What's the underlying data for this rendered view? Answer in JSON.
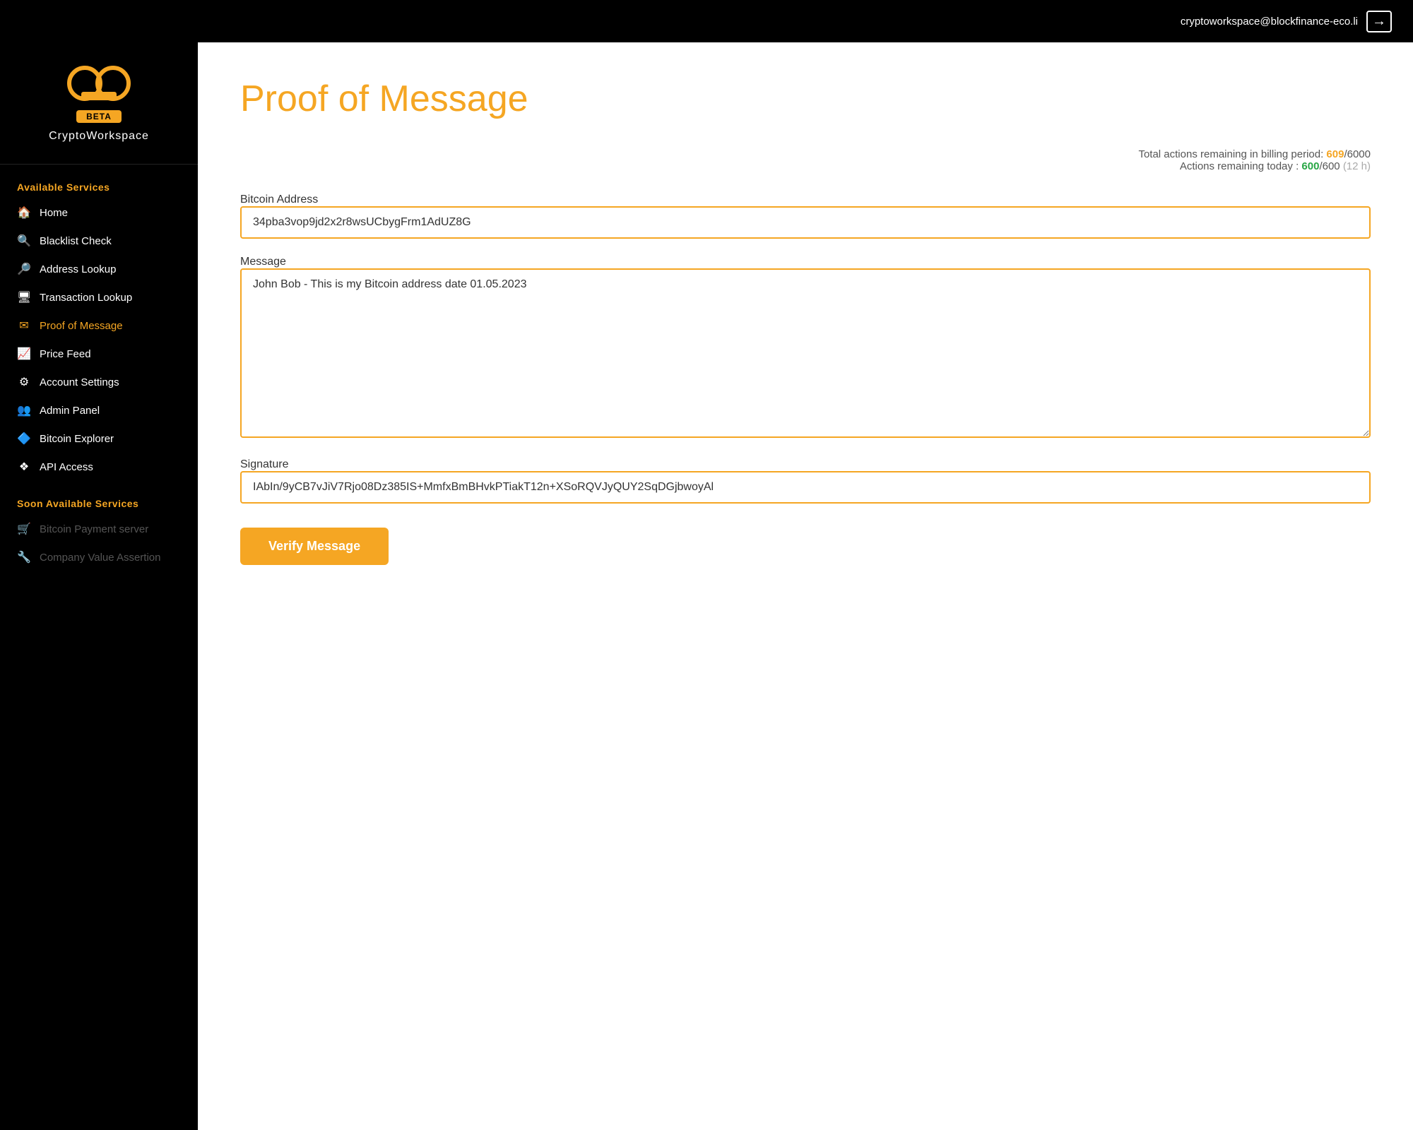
{
  "topbar": {
    "email": "cryptoworkspace@blockfinance-eco.li",
    "logout_icon": "→"
  },
  "sidebar": {
    "brand_name": "CryptoWorkspace",
    "beta_label": "BETA",
    "available_services_title": "Available Services",
    "soon_available_title": "Soon Available Services",
    "nav_items": [
      {
        "label": "Home",
        "icon": "🏠",
        "active": false,
        "disabled": false
      },
      {
        "label": "Blacklist Check",
        "icon": "🔍",
        "active": false,
        "disabled": false
      },
      {
        "label": "Address Lookup",
        "icon": "🔎",
        "active": false,
        "disabled": false
      },
      {
        "label": "Transaction Lookup",
        "icon": "🖥",
        "active": false,
        "disabled": false
      },
      {
        "label": "Proof of Message",
        "icon": "✉",
        "active": true,
        "disabled": false
      },
      {
        "label": "Price Feed",
        "icon": "📈",
        "active": false,
        "disabled": false
      },
      {
        "label": "Account Settings",
        "icon": "⚙",
        "active": false,
        "disabled": false
      },
      {
        "label": "Admin Panel",
        "icon": "👥",
        "active": false,
        "disabled": false
      },
      {
        "label": "Bitcoin Explorer",
        "icon": "🔷",
        "active": false,
        "disabled": false
      },
      {
        "label": "API Access",
        "icon": "❖",
        "active": false,
        "disabled": false
      }
    ],
    "soon_items": [
      {
        "label": "Bitcoin Payment server",
        "icon": "🛒",
        "disabled": true
      },
      {
        "label": "Company Value Assertion",
        "icon": "🔧",
        "disabled": true
      }
    ]
  },
  "main": {
    "page_title": "Proof of Message",
    "billing": {
      "total_label": "Total actions remaining in billing period:",
      "total_used": "609",
      "total_max": "/6000",
      "today_label": "Actions remaining today :",
      "today_used": "600",
      "today_max": "/600",
      "today_period": "(12 h)"
    },
    "bitcoin_address_label": "Bitcoin Address",
    "bitcoin_address_value": "34pba3vop9jd2x2r8wsUCbygFrm1AdUZ8G",
    "message_label": "Message",
    "message_value": "John Bob - This is my Bitcoin address date 01.05.2023",
    "signature_label": "Signature",
    "signature_value": "IAbIn/9yCB7vJiV7Rjo08Dz385IS+MmfxBmBHvkPTiakT12n+XSoRQVJyQUY2SqDGjbwoyAl",
    "verify_button": "Verify Message"
  }
}
